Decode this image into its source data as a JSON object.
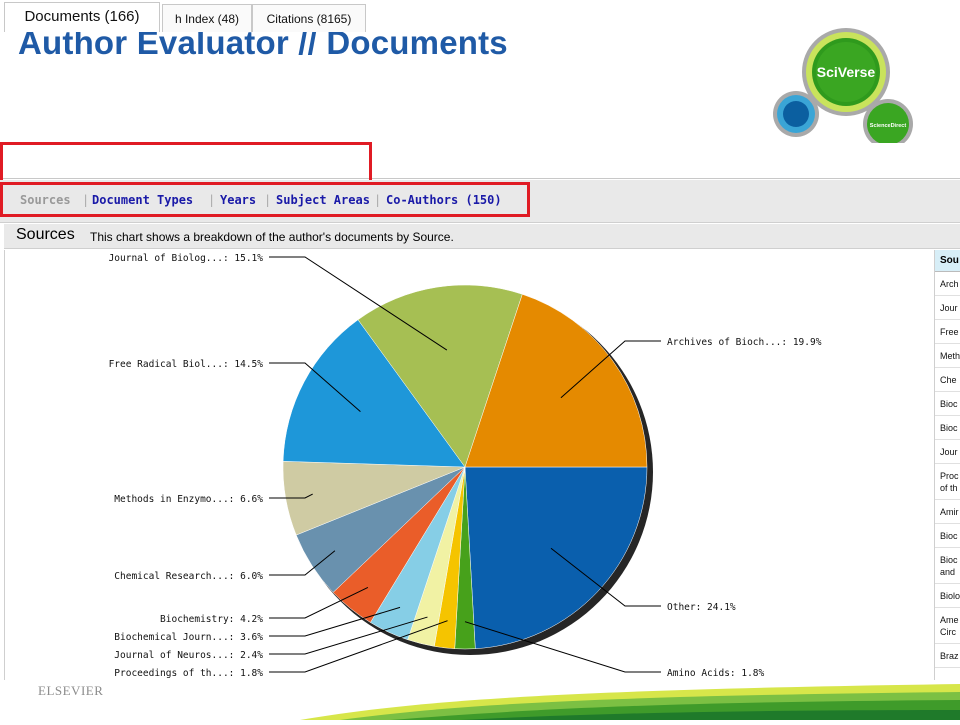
{
  "header": {
    "title": "Author Evaluator // Documents"
  },
  "logo": {
    "primary": "SciVerse",
    "secondary": "ScienceDirect"
  },
  "tabs": [
    {
      "label": "Documents (166)",
      "active": true
    },
    {
      "label": "h Index (48)",
      "active": false
    },
    {
      "label": "Citations (8165)",
      "active": false
    }
  ],
  "subnav": {
    "items": [
      "Sources",
      "Document Types",
      "Years",
      "Subject Areas",
      "Co-Authors (150)"
    ],
    "active": "Sources"
  },
  "section": {
    "title": "Sources",
    "description": "This chart shows a breakdown of the author's documents by Source."
  },
  "right_table": {
    "header": "Sou",
    "rows": [
      "Arch",
      "Jour",
      "Free",
      "Meth",
      "Che",
      "Bioc",
      "Bioc",
      "Jour",
      "Proc\nof th",
      "Amir",
      "Bioc",
      "Bioc\nand",
      "Biolo",
      "Ame\nCirc",
      "Braz"
    ]
  },
  "chart_data": {
    "type": "pie",
    "title": "",
    "slices": [
      {
        "label": "Other: 24.1%",
        "value": 24.1,
        "color": "#0a5fad"
      },
      {
        "label": "Amino Acids: 1.8%",
        "value": 1.8,
        "color": "#47a11b"
      },
      {
        "label": "Proceedings of th...: 1.8%",
        "value": 1.8,
        "color": "#f5c400"
      },
      {
        "label": "Journal of Neuros...: 2.4%",
        "value": 2.4,
        "color": "#f1f2a4"
      },
      {
        "label": "Biochemical Journ...: 3.6%",
        "value": 3.6,
        "color": "#86cee6"
      },
      {
        "label": "Biochemistry: 4.2%",
        "value": 4.2,
        "color": "#ea5d29"
      },
      {
        "label": "Chemical Research...: 6.0%",
        "value": 6.0,
        "color": "#6991ae"
      },
      {
        "label": "Methods in Enzymo...: 6.6%",
        "value": 6.6,
        "color": "#cfcba3"
      },
      {
        "label": "Free Radical Biol...: 14.5%",
        "value": 14.5,
        "color": "#1e97d9"
      },
      {
        "label": "Journal of Biolog...: 15.1%",
        "value": 15.1,
        "color": "#a6bf53"
      },
      {
        "label": "Archives of Bioch...: 19.9%",
        "value": 19.9,
        "color": "#e58a00"
      }
    ]
  },
  "footer": {
    "brand": "ELSEVIER"
  }
}
